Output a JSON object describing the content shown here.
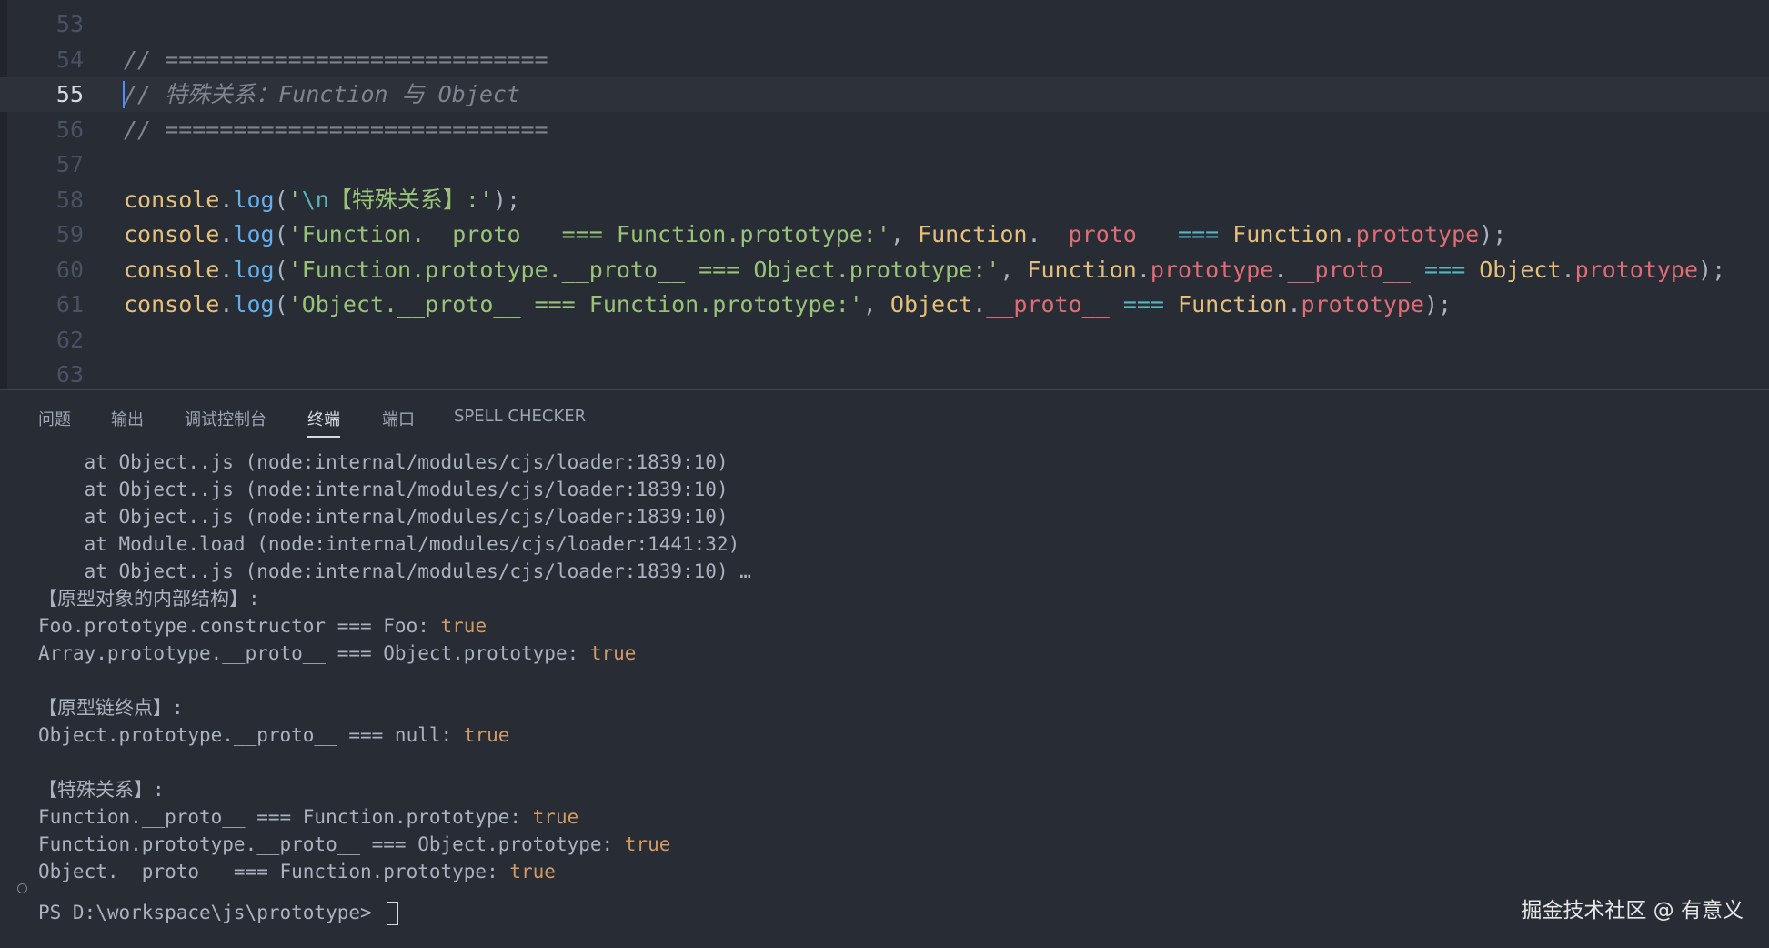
{
  "editor": {
    "lines": [
      {
        "num": "53",
        "parts": []
      },
      {
        "num": "54",
        "parts": [
          {
            "c": "cm",
            "t": "// ============================"
          }
        ]
      },
      {
        "num": "55",
        "active": true,
        "parts": [
          {
            "c": "cm",
            "t": "// 特殊关系：Function 与 Object"
          }
        ]
      },
      {
        "num": "56",
        "parts": [
          {
            "c": "cm",
            "t": "// ============================"
          }
        ]
      },
      {
        "num": "57",
        "parts": []
      },
      {
        "num": "58",
        "parts": [
          {
            "c": "obj",
            "t": "console"
          },
          {
            "c": "pn",
            "t": "."
          },
          {
            "c": "fn",
            "t": "log"
          },
          {
            "c": "pn",
            "t": "("
          },
          {
            "c": "str",
            "t": "'"
          },
          {
            "c": "esc",
            "t": "\\n"
          },
          {
            "c": "str",
            "t": "【特殊关系】:'"
          },
          {
            "c": "pn",
            "t": ");"
          }
        ]
      },
      {
        "num": "59",
        "parts": [
          {
            "c": "obj",
            "t": "console"
          },
          {
            "c": "pn",
            "t": "."
          },
          {
            "c": "fn",
            "t": "log"
          },
          {
            "c": "pn",
            "t": "("
          },
          {
            "c": "str",
            "t": "'Function.__proto__ === Function.prototype:'"
          },
          {
            "c": "pn",
            "t": ", "
          },
          {
            "c": "obj",
            "t": "Function"
          },
          {
            "c": "pn",
            "t": "."
          },
          {
            "c": "prop",
            "t": "__proto__"
          },
          {
            "c": "pn",
            "t": " "
          },
          {
            "c": "op",
            "t": "==="
          },
          {
            "c": "pn",
            "t": " "
          },
          {
            "c": "obj",
            "t": "Function"
          },
          {
            "c": "pn",
            "t": "."
          },
          {
            "c": "prop",
            "t": "prototype"
          },
          {
            "c": "pn",
            "t": ");"
          }
        ]
      },
      {
        "num": "60",
        "parts": [
          {
            "c": "obj",
            "t": "console"
          },
          {
            "c": "pn",
            "t": "."
          },
          {
            "c": "fn",
            "t": "log"
          },
          {
            "c": "pn",
            "t": "("
          },
          {
            "c": "str",
            "t": "'Function.prototype.__proto__ === Object.prototype:'"
          },
          {
            "c": "pn",
            "t": ", "
          },
          {
            "c": "obj",
            "t": "Function"
          },
          {
            "c": "pn",
            "t": "."
          },
          {
            "c": "prop",
            "t": "prototype"
          },
          {
            "c": "pn",
            "t": "."
          },
          {
            "c": "prop",
            "t": "__proto__"
          },
          {
            "c": "pn",
            "t": " "
          },
          {
            "c": "op",
            "t": "==="
          },
          {
            "c": "pn",
            "t": " "
          },
          {
            "c": "obj",
            "t": "Object"
          },
          {
            "c": "pn",
            "t": "."
          },
          {
            "c": "prop",
            "t": "prototype"
          },
          {
            "c": "pn",
            "t": ");"
          }
        ]
      },
      {
        "num": "61",
        "parts": [
          {
            "c": "obj",
            "t": "console"
          },
          {
            "c": "pn",
            "t": "."
          },
          {
            "c": "fn",
            "t": "log"
          },
          {
            "c": "pn",
            "t": "("
          },
          {
            "c": "str",
            "t": "'Object.__proto__ === Function.prototype:'"
          },
          {
            "c": "pn",
            "t": ", "
          },
          {
            "c": "obj",
            "t": "Object"
          },
          {
            "c": "pn",
            "t": "."
          },
          {
            "c": "prop",
            "t": "__proto__"
          },
          {
            "c": "pn",
            "t": " "
          },
          {
            "c": "op",
            "t": "==="
          },
          {
            "c": "pn",
            "t": " "
          },
          {
            "c": "obj",
            "t": "Function"
          },
          {
            "c": "pn",
            "t": "."
          },
          {
            "c": "prop",
            "t": "prototype"
          },
          {
            "c": "pn",
            "t": ");"
          }
        ]
      },
      {
        "num": "62",
        "parts": []
      },
      {
        "num": "63",
        "parts": []
      }
    ]
  },
  "panel": {
    "tabs": [
      {
        "label": "问题",
        "name": "tab-problems"
      },
      {
        "label": "输出",
        "name": "tab-output"
      },
      {
        "label": "调试控制台",
        "name": "tab-debug-console"
      },
      {
        "label": "终端",
        "name": "tab-terminal",
        "active": true
      },
      {
        "label": "端口",
        "name": "tab-ports"
      },
      {
        "label": "SPELL CHECKER",
        "name": "tab-spell-checker"
      }
    ]
  },
  "terminal": {
    "lines": [
      {
        "text": "    at Object..js (node:internal/modules/cjs/loader:1839:10)",
        "value": ""
      },
      {
        "text": "    at Object..js (node:internal/modules/cjs/loader:1839:10)",
        "value": ""
      },
      {
        "text": "    at Object..js (node:internal/modules/cjs/loader:1839:10)",
        "value": ""
      },
      {
        "text": "    at Module.load (node:internal/modules/cjs/loader:1441:32)",
        "value": ""
      },
      {
        "text": "    at Object..js (node:internal/modules/cjs/loader:1839:10) …",
        "value": ""
      },
      {
        "text": "【原型对象的内部结构】:",
        "value": ""
      },
      {
        "text": "Foo.prototype.constructor === Foo: ",
        "value": "true"
      },
      {
        "text": "Array.prototype.__proto__ === Object.prototype: ",
        "value": "true"
      },
      {
        "text": "",
        "value": ""
      },
      {
        "text": "【原型链终点】:",
        "value": ""
      },
      {
        "text": "Object.prototype.__proto__ === null: ",
        "value": "true"
      },
      {
        "text": "",
        "value": ""
      },
      {
        "text": "【特殊关系】:",
        "value": ""
      },
      {
        "text": "Function.__proto__ === Function.prototype: ",
        "value": "true"
      },
      {
        "text": "Function.prototype.__proto__ === Object.prototype: ",
        "value": "true"
      },
      {
        "text": "Object.__proto__ === Function.prototype: ",
        "value": "true"
      }
    ],
    "prompt": "PS D:\\workspace\\js\\prototype> "
  },
  "watermark": "掘金技术社区 @ 有意义"
}
